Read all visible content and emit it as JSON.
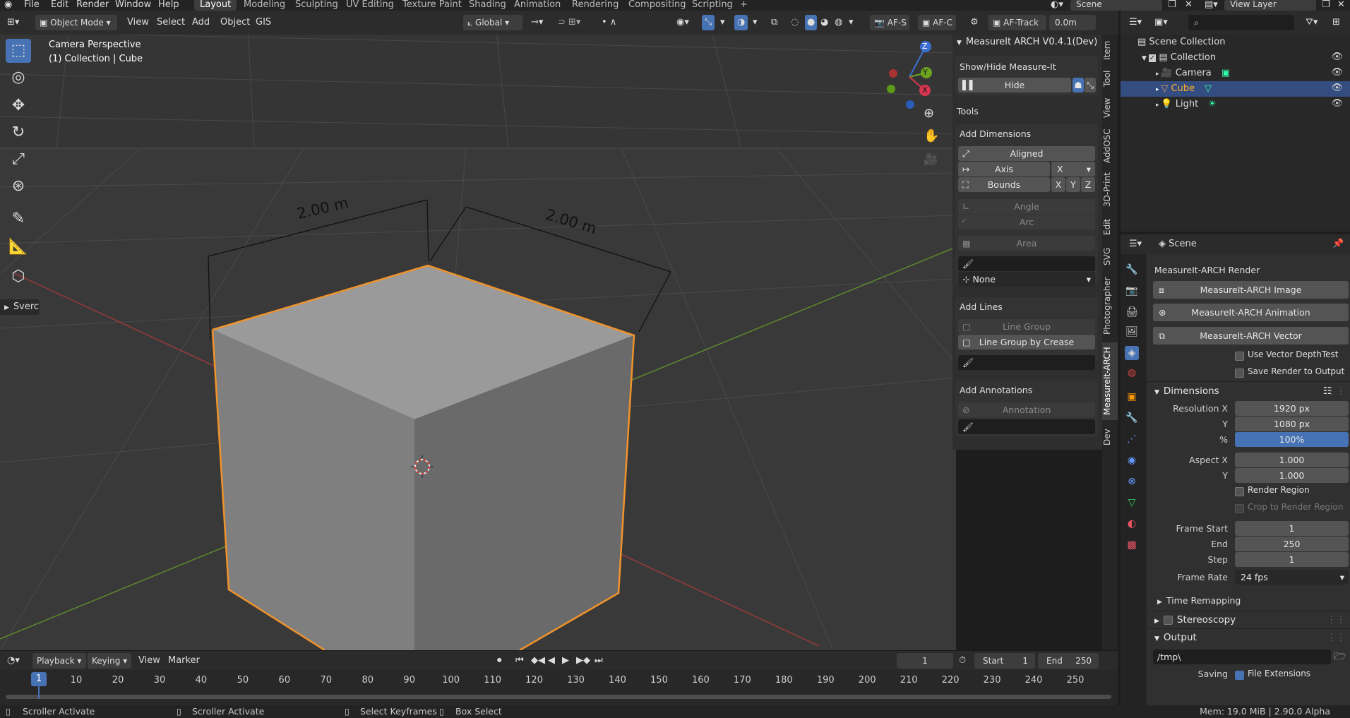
{
  "menu": {
    "items": [
      "File",
      "Edit",
      "Render",
      "Window",
      "Help"
    ],
    "workspace_tabs": [
      "Layout",
      "Modeling",
      "Sculpting",
      "UV Editing",
      "Texture Paint",
      "Shading",
      "Animation",
      "Rendering",
      "Compositing",
      "Scripting"
    ],
    "active_tab": "Layout",
    "scene_name": "Scene",
    "view_layer": "View Layer"
  },
  "viewport_header": {
    "mode": "Object Mode",
    "menus": [
      "View",
      "Select",
      "Add",
      "Object",
      "GIS"
    ],
    "orientation": "Global",
    "af_s": "AF-S",
    "af_c": "AF-C",
    "af_track": "AF-Track",
    "distance": "0.0m"
  },
  "viewport": {
    "title": "Camera Perspective",
    "subtitle": "(1) Collection | Cube",
    "dim_left": "2.00 m",
    "dim_right": "2.00 m",
    "collapsed_panel": "Sverc",
    "gizmo": {
      "x": "X",
      "y": "Y",
      "z": "Z"
    }
  },
  "n_panel": {
    "title": "MeasureIt ARCH V0.4.1(Dev)",
    "show_hide_label": "Show/Hide Measure-It",
    "hide_button": "Hide",
    "tools_label": "Tools",
    "add_dimensions": "Add Dimensions",
    "aligned": "Aligned",
    "axis": "Axis",
    "axis_value": "X",
    "bounds": "Bounds",
    "bounds_axes": [
      "X",
      "Y",
      "Z"
    ],
    "angle": "Angle",
    "arc": "Arc",
    "area": "Area",
    "none_select": "None",
    "add_lines": "Add Lines",
    "line_group": "Line Group",
    "line_group_crease": "Line Group by Crease",
    "add_annotations": "Add Annotations",
    "annotation": "Annotation",
    "side_tabs": [
      "Item",
      "Tool",
      "View",
      "AddOSC",
      "3D-Print",
      "Edit",
      "SVG",
      "Photographer",
      "MeasureIt-ARCH",
      "Dev"
    ]
  },
  "outliner": {
    "scene_collection": "Scene Collection",
    "items": [
      {
        "name": "Collection",
        "icon": "collection-icon"
      },
      {
        "name": "Camera",
        "icon": "camera-icon"
      },
      {
        "name": "Cube",
        "icon": "mesh-icon"
      },
      {
        "name": "Light",
        "icon": "light-icon"
      }
    ],
    "selected": "Cube"
  },
  "properties": {
    "context": "Scene",
    "section": "MeasureIt-ARCH Render",
    "buttons": [
      "MeasureIt-ARCH Image",
      "MeasureIt-ARCH Animation",
      "MeasureIt-ARCH Vector"
    ],
    "use_vector_depth": "Use Vector DepthTest",
    "save_render": "Save Render to Output",
    "dimensions": "Dimensions",
    "resolution_x_label": "Resolution X",
    "resolution_x": "1920 px",
    "resolution_y_label": "Y",
    "resolution_y": "1080 px",
    "percent_label": "%",
    "percent": "100%",
    "percent_value": 1.0,
    "aspect_x_label": "Aspect X",
    "aspect_x": "1.000",
    "aspect_y_label": "Y",
    "aspect_y": "1.000",
    "render_region": "Render Region",
    "crop_region": "Crop to Render Region",
    "frame_start_label": "Frame Start",
    "frame_start": "1",
    "frame_end_label": "End",
    "frame_end": "250",
    "frame_step_label": "Step",
    "frame_step": "1",
    "frame_rate_label": "Frame Rate",
    "frame_rate": "24 fps",
    "time_remapping": "Time Remapping",
    "stereoscopy": "Stereoscopy",
    "output": "Output",
    "output_path": "/tmp\\",
    "saving_label": "Saving",
    "file_extensions": "File Extensions"
  },
  "timeline": {
    "menus": [
      "Playback",
      "Keying",
      "View",
      "Marker"
    ],
    "current_frame": "1",
    "start_label": "Start",
    "start": "1",
    "end_label": "End",
    "end": "250",
    "ticks": [
      "1",
      "10",
      "20",
      "30",
      "40",
      "50",
      "60",
      "70",
      "80",
      "90",
      "100",
      "110",
      "120",
      "130",
      "140",
      "150",
      "160",
      "170",
      "180",
      "190",
      "200",
      "210",
      "220",
      "230",
      "240",
      "250"
    ]
  },
  "statusbar": {
    "items": [
      "Scroller Activate",
      "Scroller Activate",
      "Select Keyframes",
      "Box Select"
    ],
    "memory": "Mem: 19.0 MiB | 2.90.0 Alpha"
  }
}
